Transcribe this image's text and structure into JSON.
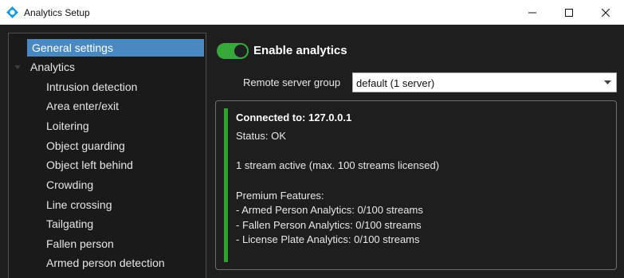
{
  "window": {
    "title": "Analytics Setup",
    "icon": "analytics-app-icon",
    "buttons": [
      "minimize-icon",
      "maximize-icon",
      "close-icon"
    ]
  },
  "sidebar": {
    "items": [
      {
        "label": "General settings",
        "selected": true
      },
      {
        "label": "Analytics",
        "expanded": true
      },
      {
        "label": "Intrusion detection"
      },
      {
        "label": "Area enter/exit"
      },
      {
        "label": "Loitering"
      },
      {
        "label": "Object guarding"
      },
      {
        "label": "Object left behind"
      },
      {
        "label": "Crowding"
      },
      {
        "label": "Line crossing"
      },
      {
        "label": "Tailgating"
      },
      {
        "label": "Fallen person"
      },
      {
        "label": "Armed person detection"
      }
    ]
  },
  "main": {
    "enable_label": "Enable analytics",
    "enable_on": true,
    "remote_label": "Remote server group",
    "remote_value": "default (1 server)",
    "status": {
      "connected": "Connected to: 127.0.0.1",
      "status": "Status: OK",
      "streams": "1 stream active (max. 100 streams licensed)",
      "premium_title": "Premium Features:",
      "premium": [
        "- Armed Person Analytics: 0/100 streams",
        "- Fallen Person Analytics: 0/100 streams",
        "- License Plate Analytics: 0/100 streams"
      ]
    }
  },
  "colors": {
    "accent": "#4a88c2",
    "toggle_on": "#36a83c",
    "status_ok": "#2aa52a"
  }
}
